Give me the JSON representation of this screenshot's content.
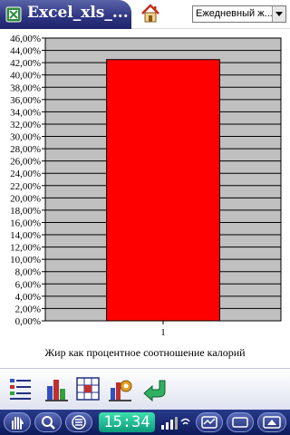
{
  "app": {
    "title": "Excel_xls_...",
    "view_select_value": "Ежедневный ж..."
  },
  "chart_data": {
    "type": "bar",
    "categories": [
      "1"
    ],
    "values": [
      42.5
    ],
    "ylim": [
      0,
      46
    ],
    "y_step": 2,
    "y_tick_labels": [
      "46,00%",
      "44,00%",
      "42,00%",
      "40,00%",
      "38,00%",
      "36,00%",
      "34,00%",
      "32,00%",
      "30,00%",
      "28,00%",
      "26,00%",
      "24,00%",
      "22,00%",
      "20,00%",
      "18,00%",
      "16,00%",
      "14,00%",
      "12,00%",
      "10,00%",
      "8,00%",
      "6,00%",
      "4,00%",
      "2,00%",
      "0,00%"
    ],
    "xlabel": "Жир как процентное соотношение калорий",
    "grid": true,
    "bar_color": "#ff0000",
    "plot_background": "#c0c0c0"
  },
  "toolbar": {
    "icons": [
      "list-icon",
      "bar-chart-icon",
      "grid-icon",
      "settings-chart-icon",
      "back-arrow-icon"
    ]
  },
  "taskbar": {
    "clock": "15:34"
  },
  "colors": {
    "title_bar": "#2d3482",
    "taskbar": "#0d1a5a",
    "clock": "#0a9a7a"
  }
}
